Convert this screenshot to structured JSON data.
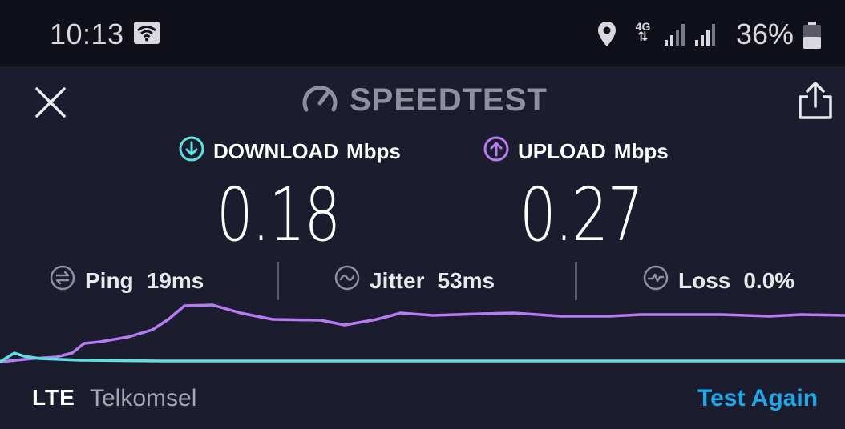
{
  "statusbar": {
    "time": "10:13",
    "network_type": "4G",
    "battery_percent": "36%",
    "icons": [
      "wifi-icon",
      "location-icon",
      "4g-data-icon",
      "signal-icon",
      "signal-icon",
      "battery-icon"
    ]
  },
  "header": {
    "brand": "SPEEDTEST",
    "close_icon": "close-icon",
    "share_icon": "share-icon"
  },
  "download": {
    "label": "DOWNLOAD",
    "unit": "Mbps",
    "value": "0.18",
    "color": "#5ee0e0"
  },
  "upload": {
    "label": "UPLOAD",
    "unit": "Mbps",
    "value": "0.27",
    "color": "#b77cf2"
  },
  "stats": {
    "ping_label": "Ping",
    "ping_value": "19ms",
    "jitter_label": "Jitter",
    "jitter_value": "53ms",
    "loss_label": "Loss",
    "loss_value": "0.0%"
  },
  "footer": {
    "connection": "LTE",
    "carrier": "Telkomsel",
    "test_again": "Test Again",
    "accent": "#1fa7e8"
  }
}
